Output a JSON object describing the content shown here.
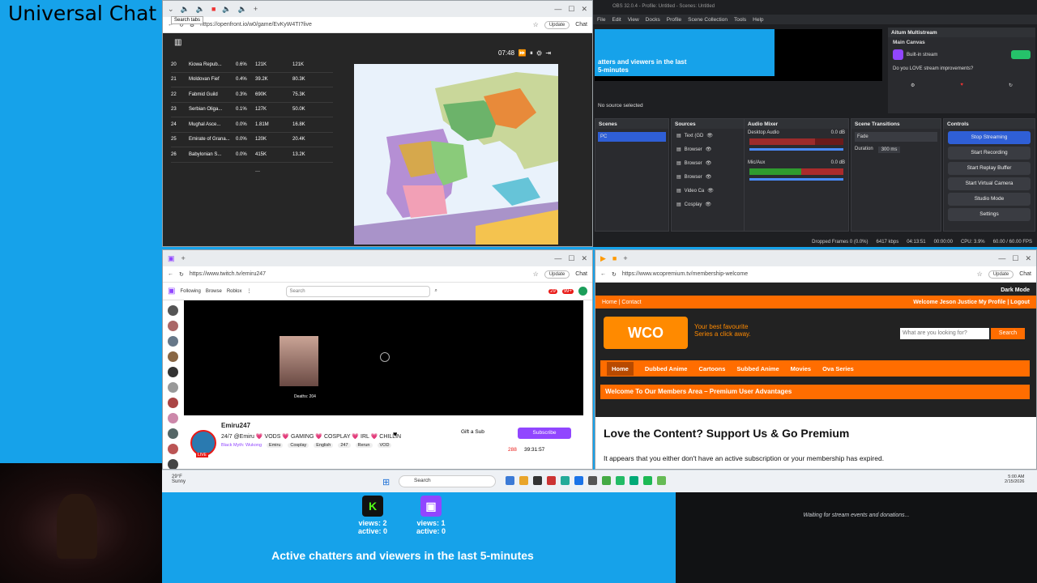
{
  "overlay": {
    "title": "Universal Chat",
    "kick_views": "views: 2",
    "kick_active": "active: 0",
    "twitch_views": "views: 1",
    "twitch_active": "active: 0",
    "active_caption": "Active chatters and viewers in the last 5-minutes",
    "waiting_text": "Waiting for stream events and donations..."
  },
  "browser1": {
    "tooltip": "Search tabs",
    "url": "https://openfront.io/w0/game/EvKyW4TI?live",
    "update_label": "Update",
    "chat_label": "Chat",
    "timer": "07:48",
    "leaderboard": [
      {
        "rank": "20",
        "name": "Kiowa Repub...",
        "pct": "0.6%",
        "gold": "121K",
        "troops": "121K"
      },
      {
        "rank": "21",
        "name": "Moldovan Fief",
        "pct": "0.4%",
        "gold": "39.2K",
        "troops": "80.3K"
      },
      {
        "rank": "22",
        "name": "Fabmid Guild",
        "pct": "0.3%",
        "gold": "690K",
        "troops": "75.3K"
      },
      {
        "rank": "23",
        "name": "Serbian Oliga...",
        "pct": "0.1%",
        "gold": "127K",
        "troops": "50.0K"
      },
      {
        "rank": "24",
        "name": "Mughal Asce...",
        "pct": "0.0%",
        "gold": "1.81M",
        "troops": "16.8K"
      },
      {
        "rank": "25",
        "name": "Emirate of Grana...",
        "pct": "0.0%",
        "gold": "120K",
        "troops": "20.4K"
      },
      {
        "rank": "26",
        "name": "Babylonian S...",
        "pct": "0.0%",
        "gold": "415K",
        "troops": "13.2K"
      }
    ]
  },
  "obs": {
    "title": "OBS 32.0.4 - Profile: Untitled - Scenes: Untitled",
    "menu": [
      "File",
      "Edit",
      "View",
      "Docks",
      "Profile",
      "Scene Collection",
      "Tools",
      "Help"
    ],
    "preview_text": "atters and viewers in the last\n5-minutes",
    "multistream_title": "Aitum Multistream",
    "main_canvas": "Main Canvas",
    "builtin_stream": "Built-in stream",
    "improvements": "Do you LOVE stream improvements?",
    "no_source": "No source selected",
    "scenes_h": "Scenes",
    "scene_pc": "PC",
    "sources_h": "Sources",
    "sources": [
      "Text (GD",
      "Browser",
      "Browser",
      "Browser",
      "Video Ca",
      "Cosplay"
    ],
    "mixer_h": "Audio Mixer",
    "desktop_audio": "Desktop Audio",
    "mic_aux": "Mic/Aux",
    "db": "0.0 dB",
    "transitions_h": "Scene Transitions",
    "fade": "Fade",
    "duration_label": "Duration",
    "duration_val": "300 ms",
    "controls_h": "Controls",
    "buttons": [
      "Stop Streaming",
      "Start Recording",
      "Start Replay Buffer",
      "Start Virtual Camera",
      "Studio Mode",
      "Settings"
    ],
    "status": {
      "dropped": "Dropped Frames 0 (0.0%)",
      "kbps": "6417 kbps",
      "live": "04:13:51",
      "rec": "00:00:00",
      "cpu": "CPU: 3.9%",
      "fps": "60.00 / 60.00 FPS"
    }
  },
  "twitch": {
    "url": "https://www.twitch.tv/emiru247",
    "nav_following": "Following",
    "nav_browse": "Browse",
    "nav_roblox": "Roblox",
    "search_placeholder": "Search",
    "badge1": "29",
    "badge2": "99+",
    "streamer": "Emiru247",
    "stream_title": "24/7 @Emiru 💗 VODS 💗 GAMING 💗 COSPLAY 💗 IRL 💗 CHILLIN",
    "game": "Black Myth: Wukong",
    "tags": [
      "Emiru",
      "Cosplay",
      "English",
      "247",
      "Rerun",
      "VOD"
    ],
    "live": "LIVE",
    "gift_sub": "Gift a Sub",
    "subscribe": "Subscribe",
    "viewers": "288",
    "uptime": "39:31:57",
    "deaths": "Deaths: 204"
  },
  "wco": {
    "url": "https://www.wcopremium.tv/membership-welcome",
    "dark_mode": "Dark Mode",
    "home_link": "Home",
    "contact_link": "Contact",
    "welcome_user": "Welcome Jeson Justice My Profile | Logout",
    "tagline1": "Your best favourite",
    "tagline2": "Series a click away.",
    "search_placeholder": "What are you looking for?",
    "search_btn": "Search",
    "nav": [
      "Home",
      "Dubbed Anime",
      "Cartoons",
      "Subbed Anime",
      "Movies",
      "Ova Series"
    ],
    "members_bar": "Welcome To Our Members Area – Premium User Advantages",
    "headline": "Love the Content? Support Us & Go Premium",
    "body": "It appears that you either don't have an active subscription or your membership has expired."
  },
  "taskbar": {
    "weather_temp": "29°F",
    "weather_desc": "Sunny",
    "search": "Search",
    "time": "5:00 AM",
    "date": "2/15/2026"
  }
}
